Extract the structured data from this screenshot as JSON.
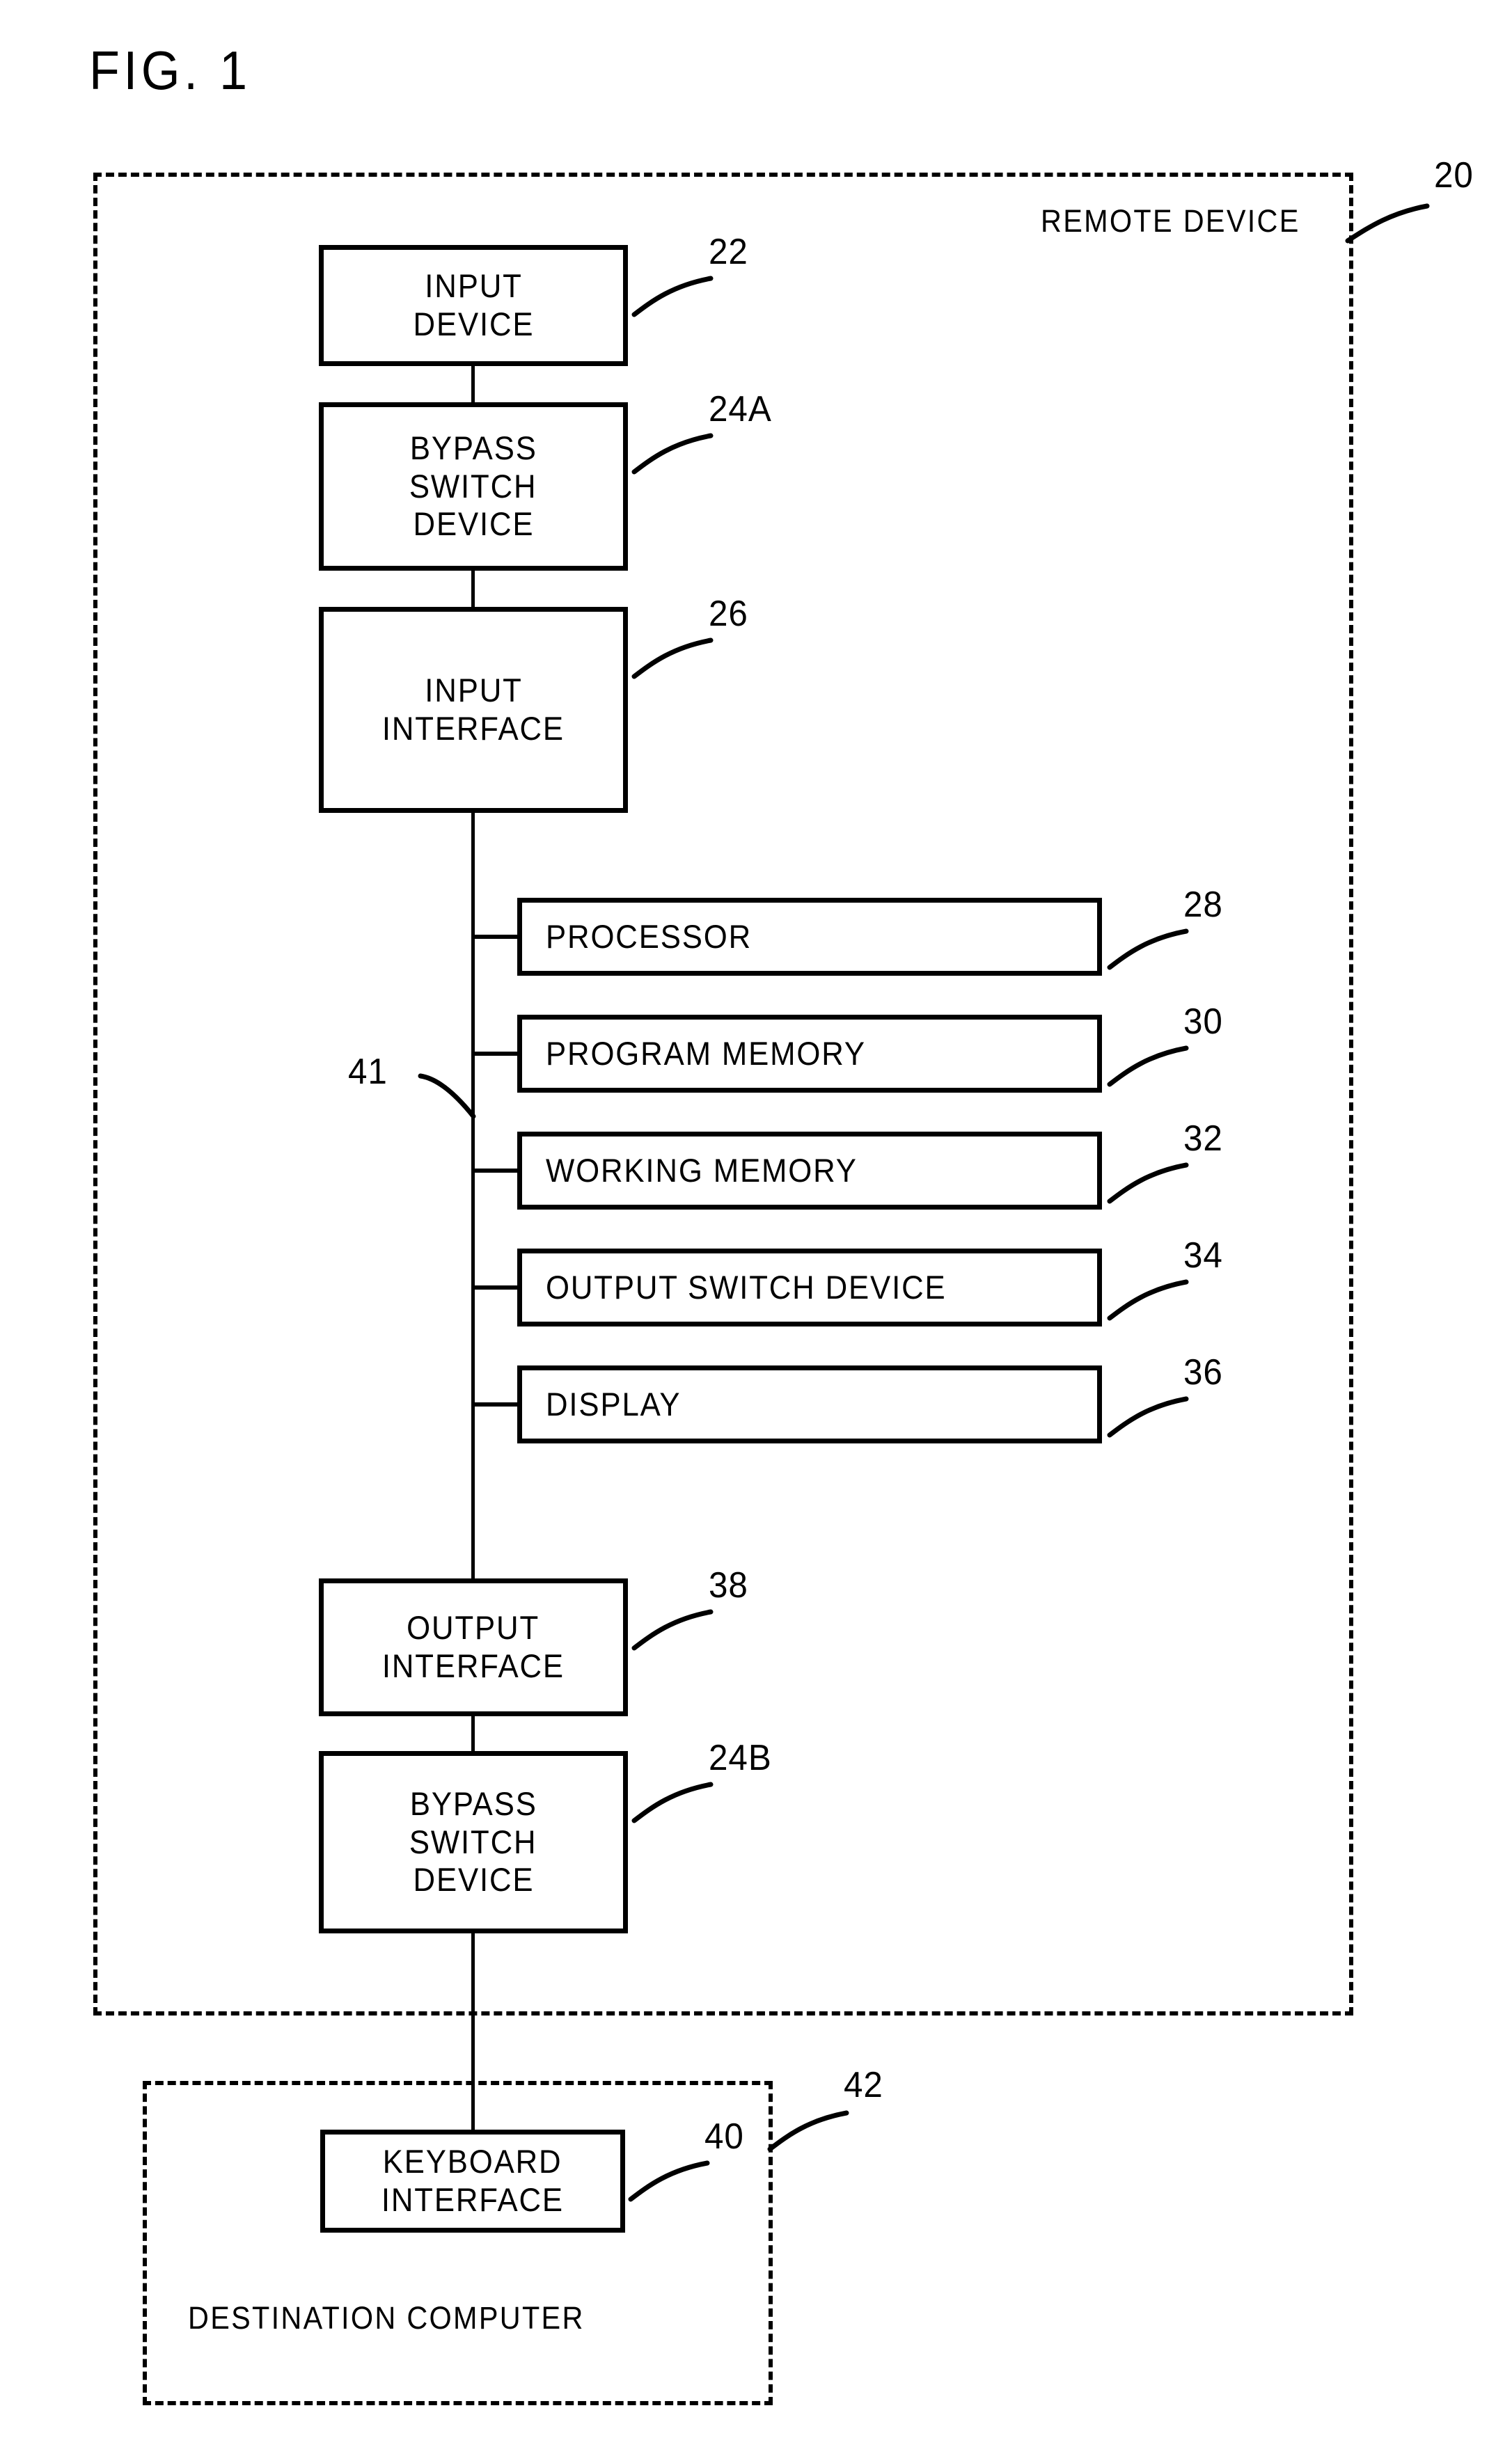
{
  "figure": {
    "title": "FIG. 1"
  },
  "enclosures": [
    {
      "id": "remote_device",
      "label": "REMOTE DEVICE",
      "ref": "20"
    },
    {
      "id": "destination_computer",
      "label": "DESTINATION COMPUTER",
      "ref": "42"
    }
  ],
  "blocks": [
    {
      "id": "input_device",
      "lines": [
        "INPUT",
        "DEVICE"
      ],
      "ref": "22"
    },
    {
      "id": "bypass_switch_a",
      "lines": [
        "BYPASS",
        "SWITCH",
        "DEVICE"
      ],
      "ref": "24A"
    },
    {
      "id": "input_interface",
      "lines": [
        "INPUT",
        "INTERFACE"
      ],
      "ref": "26"
    },
    {
      "id": "processor",
      "lines": [
        "PROCESSOR"
      ],
      "ref": "28"
    },
    {
      "id": "program_memory",
      "lines": [
        "PROGRAM  MEMORY"
      ],
      "ref": "30"
    },
    {
      "id": "working_memory",
      "lines": [
        "WORKING  MEMORY"
      ],
      "ref": "32"
    },
    {
      "id": "output_switch",
      "lines": [
        "OUTPUT  SWITCH  DEVICE"
      ],
      "ref": "34"
    },
    {
      "id": "display",
      "lines": [
        "DISPLAY"
      ],
      "ref": "36"
    },
    {
      "id": "output_interface",
      "lines": [
        "OUTPUT",
        "INTERFACE"
      ],
      "ref": "38"
    },
    {
      "id": "bypass_switch_b",
      "lines": [
        "BYPASS",
        "SWITCH",
        "DEVICE"
      ],
      "ref": "24B"
    },
    {
      "id": "keyboard_interface",
      "lines": [
        "KEYBOARD",
        "INTERFACE"
      ],
      "ref": "40"
    }
  ],
  "bus": {
    "id": "internal_bus",
    "ref": "41"
  },
  "colors": {
    "ink": "#000000",
    "paper": "#ffffff"
  }
}
